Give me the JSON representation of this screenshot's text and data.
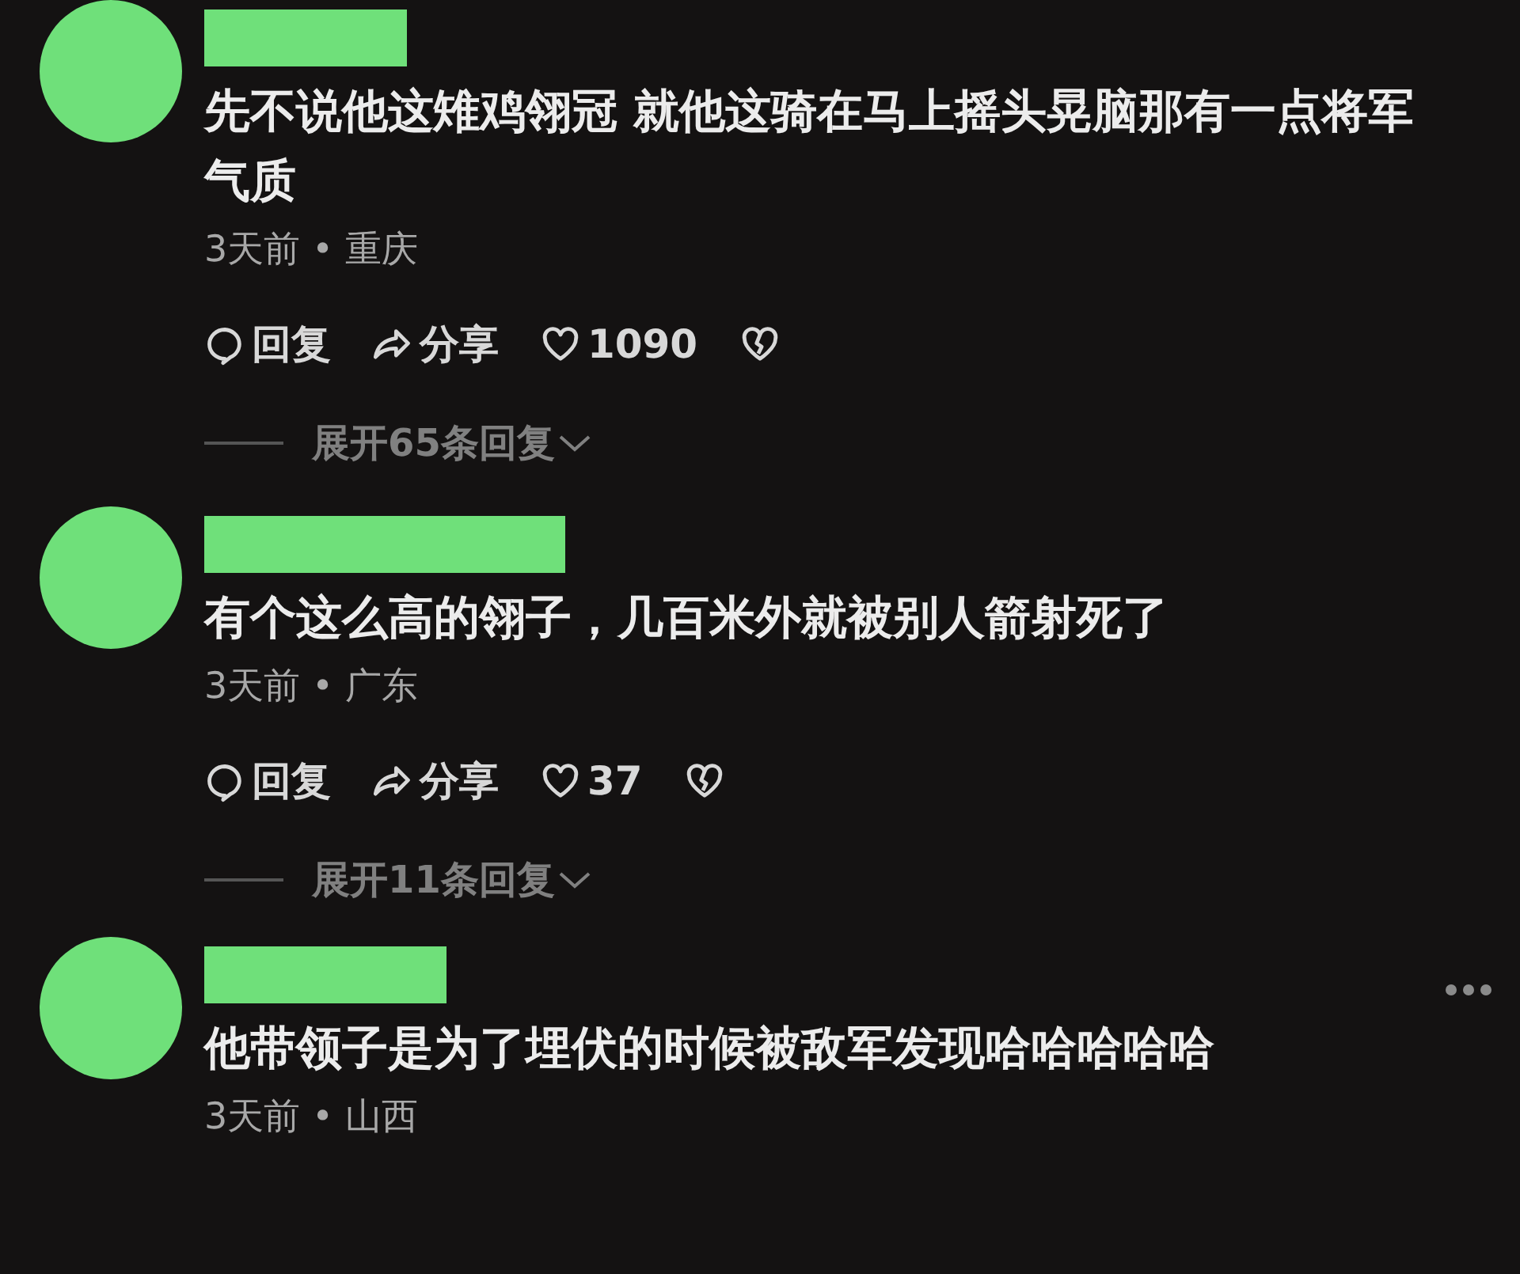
{
  "comments": [
    {
      "text": "先不说他这雉鸡翎冠 就他这骑在马上摇头晃脑那有一点将军气质",
      "meta": "3天前 • 重庆",
      "actions": {
        "reply": "回复",
        "share": "分享",
        "likes": "1090"
      },
      "expand": "展开65条回复",
      "more_menu": false
    },
    {
      "text": "有个这么高的翎子，几百米外就被别人箭射死了",
      "meta": "3天前 • 广东",
      "actions": {
        "reply": "回复",
        "share": "分享",
        "likes": "37"
      },
      "expand": "展开11条回复",
      "more_menu": false
    },
    {
      "text": "他带领子是为了埋伏的时候被敌军发现哈哈哈哈哈",
      "meta": "3天前 • 山西",
      "more_menu": true
    }
  ]
}
